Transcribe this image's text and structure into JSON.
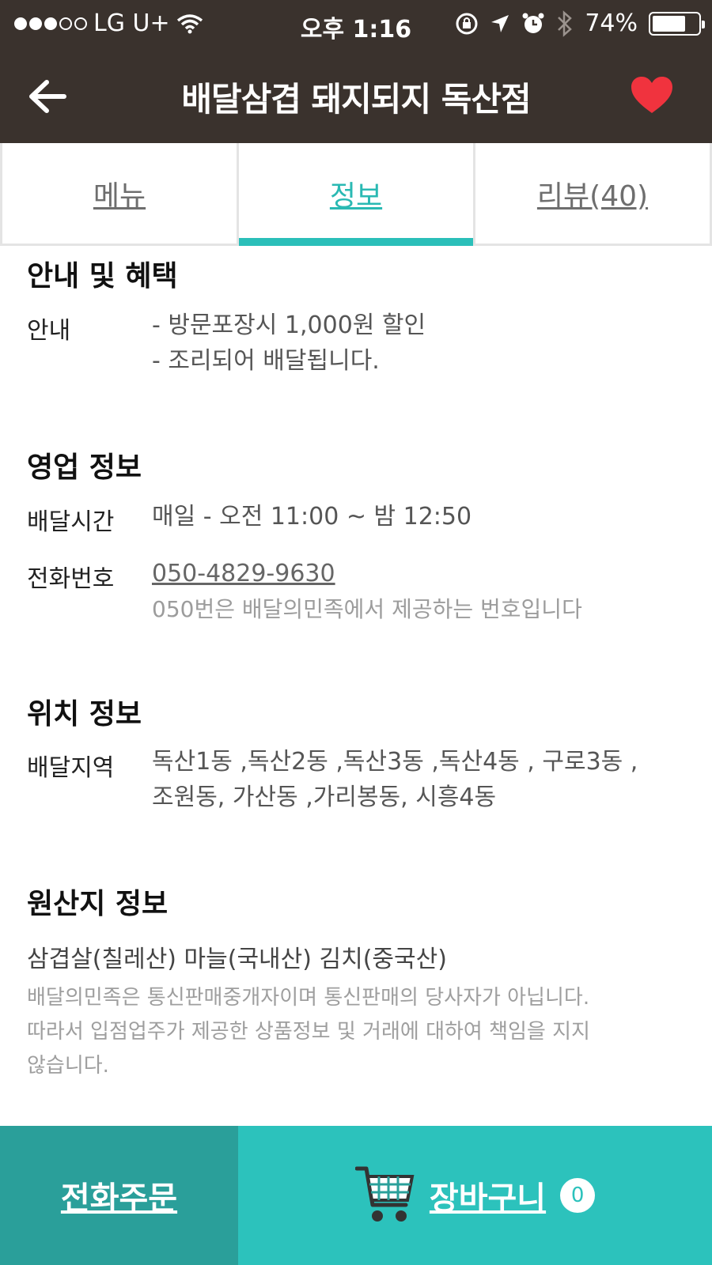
{
  "status_bar": {
    "carrier": "LG U+",
    "time": "오후 1:16",
    "battery": "74%",
    "battery_level": 0.74,
    "icons": [
      "wifi-icon",
      "rotation-lock-icon",
      "location-arrow-icon",
      "alarm-icon",
      "bluetooth-icon",
      "battery-icon"
    ]
  },
  "header": {
    "title": "배달삼겹 돼지되지 독산점",
    "back_icon": "back-arrow-icon",
    "favorite_icon": "heart-icon",
    "favorite_color": "#f0333e"
  },
  "tabs": [
    {
      "label": "메뉴",
      "active": false
    },
    {
      "label": "정보",
      "active": true
    },
    {
      "label": "리뷰(40)",
      "active": false
    }
  ],
  "colors": {
    "accent": "#2bbfb9",
    "header_bg": "#3a322d",
    "phone_order_bg": "#2a9f9a",
    "cart_bg": "#2cc2bc"
  },
  "info": {
    "notice": {
      "title": "안내 및 혜택",
      "label": "안내",
      "lines": [
        "- 방문포장시 1,000원 할인",
        "- 조리되어 배달됩니다."
      ]
    },
    "business": {
      "title": "영업 정보",
      "hours_label": "배달시간",
      "hours_value": "매일 - 오전 11:00 ~ 밤 12:50",
      "phone_label": "전화번호",
      "phone_value": "050-4829-9630",
      "phone_note": "050번은 배달의민족에서 제공하는 번호입니다"
    },
    "location": {
      "title": "위치 정보",
      "area_label": "배달지역",
      "area_lines": [
        "독산1동 ,독산2동 ,독산3동 ,독산4동 , 구로3동 ,",
        "조원동, 가산동 ,가리봉동, 시흥4동"
      ]
    },
    "origin": {
      "title": "원산지 정보",
      "text": "삼겹살(칠레산) 마늘(국내산) 김치(중국산)"
    },
    "disclaimer_lines": [
      "배달의민족은 통신판매중개자이며 통신판매의 당사자가 아닙니다.",
      "따라서 입점업주가 제공한 상품정보 및 거래에 대하여 책임을 지지",
      "않습니다."
    ]
  },
  "bottom_bar": {
    "phone_order_label": "전화주문",
    "cart_label": "장바구니",
    "cart_count": "0",
    "cart_icon": "shopping-cart-icon"
  }
}
